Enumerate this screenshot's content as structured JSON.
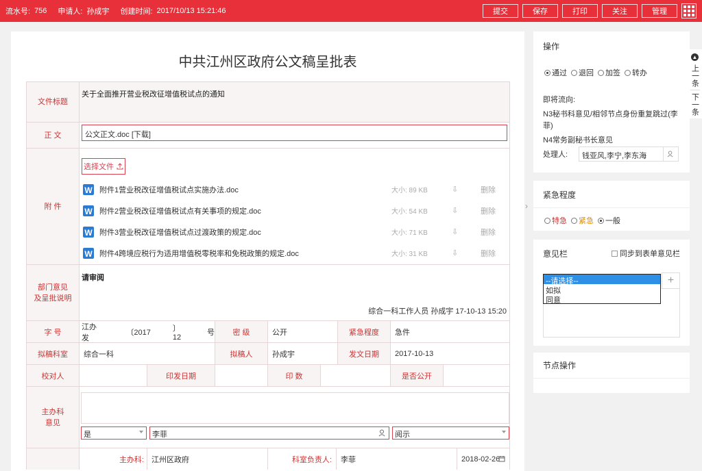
{
  "topbar": {
    "serial_label": "流水号:",
    "serial": "756",
    "applicant_label": "申请人:",
    "applicant": "孙成宇",
    "created_label": "创建时间:",
    "created": "2017/10/13 15:21:46",
    "buttons": [
      "提交",
      "保存",
      "打印",
      "关注",
      "管理"
    ]
  },
  "form": {
    "title": "中共江州区政府公文稿呈批表",
    "doc_title_label": "文件标题",
    "doc_title": "关于全面推开营业税改征增值税试点的通知",
    "body_label": "正 文",
    "body_value": "公文正文.doc [下载]",
    "attach_label": "附 件",
    "select_file": "选择文件",
    "attachments": [
      {
        "name": "附件1营业税改征增值税试点实施办法.doc",
        "size": "大小: 89 KB"
      },
      {
        "name": "附件2营业税改征增值税试点有关事项的规定.doc",
        "size": "大小: 54 KB"
      },
      {
        "name": "附件3营业税改征增值税试点过渡政策的规定.doc",
        "size": "大小: 71 KB"
      },
      {
        "name": "附件4跨境应税行为适用增值税零税率和免税政策的规定.doc",
        "size": "大小: 31 KB"
      }
    ],
    "delete_label": "删除",
    "dept_label_1": "部门意见",
    "dept_label_2": "及呈批说明",
    "dept_opinion": "请审阅",
    "dept_sign": "综合一科工作人员 孙成宇 17-10-13 15:20",
    "zihao_label": "字 号",
    "zihao_prefix": "江办发",
    "zihao_year": "〔2017",
    "zihao_num": "〕12",
    "zihao_suffix": "号",
    "secret_label": "密 级",
    "secret_value": "公开",
    "urgency_label": "紧急程度",
    "urgency_value": "急件",
    "draft_dept_label": "拟稿科室",
    "draft_dept_value": "综合一科",
    "drafter_label": "拟稿人",
    "drafter_value": "孙成宇",
    "issue_date_label": "发文日期",
    "issue_date_value": "2017-10-13",
    "proof_label": "校对人",
    "print_date_label": "印发日期",
    "copies_label": "印 数",
    "public_label": "是否公开",
    "host_label_1": "主办科",
    "host_label_2": "意见",
    "host_select": "是",
    "host_person": "李菲",
    "host_action": "阅示",
    "host_dept_label": "主办科:",
    "host_dept_value": "江州区政府",
    "dept_head_label": "科室负责人:",
    "dept_head_value": "李菲",
    "host_date": "2018-02-26"
  },
  "ops": {
    "title": "操作",
    "options": [
      "通过",
      "退回",
      "加签",
      "转办"
    ],
    "selected": 0,
    "flow_label": "即将流向:",
    "flow_1": "N3秘书科意见/相邻节点身份重复跳过(李菲)",
    "flow_2": "N4常务副秘书长意见",
    "handler_label": "处理人:",
    "handler_value": "钱亚风,李宁,李东海"
  },
  "urgency": {
    "title": "紧急程度",
    "options": [
      "特急",
      "紧急",
      "一般"
    ],
    "selected": 2
  },
  "opinion": {
    "title": "意见栏",
    "sync_label": "同步到表单意见栏",
    "dropdown": [
      "--请选择--",
      "如拟",
      "同意"
    ]
  },
  "node": {
    "title": "节点操作"
  },
  "side_tabs": [
    "上一条",
    "下一条"
  ],
  "colors": {
    "accent": "#e8303a",
    "label_red": "#cc3333"
  }
}
